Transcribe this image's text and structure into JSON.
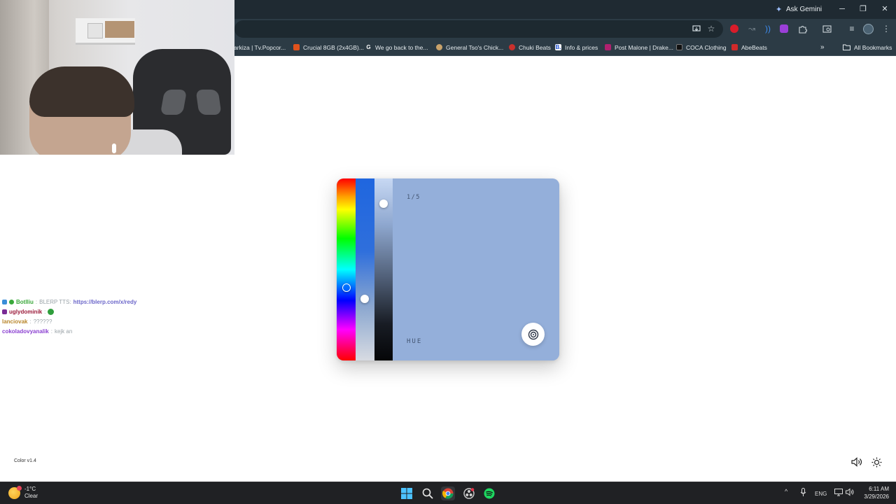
{
  "browser": {
    "ask_gemini": "Ask Gemini",
    "bookmarks": [
      {
        "label": "Markiza | Tv.Popcor...",
        "color": "#2c3b45",
        "glyph": ""
      },
      {
        "label": "Crucial 8GB (2x4GB)...",
        "color": "#e0521c",
        "glyph": ""
      },
      {
        "label": "We go back to the...",
        "color": "#ffffff",
        "glyph": "G"
      },
      {
        "label": "General Tso's Chick...",
        "color": "#c9a26a",
        "glyph": ""
      },
      {
        "label": "Chuki Beats",
        "color": "#c9302c",
        "glyph": ""
      },
      {
        "label": "Info & prices",
        "color": "#1b4fd0",
        "glyph": "B."
      },
      {
        "label": "Post Malone | Drake...",
        "color": "#b0206f",
        "glyph": ""
      },
      {
        "label": "COCA Clothing",
        "color": "#111111",
        "glyph": ""
      },
      {
        "label": "AbeBeats",
        "color": "#d12a2a",
        "glyph": ""
      }
    ],
    "all_bookmarks": "All Bookmarks"
  },
  "chat": [
    {
      "user": "Botlliu",
      "user_color": "#3aa83a",
      "sep": ":",
      "msg": "BLERP TTS:",
      "link": "https://blerp.com/x/redy"
    },
    {
      "user": "uglydominik",
      "user_color": "#9b1b3a",
      "sep": ":",
      "msg": "",
      "link": ""
    },
    {
      "user": "lanciovak",
      "user_color": "#b8862b",
      "sep": ":",
      "msg": "??????",
      "link": ""
    },
    {
      "user": "cokoladovyanalik",
      "user_color": "#8a3fd1",
      "sep": ":",
      "msg": "kejk an",
      "link": ""
    }
  ],
  "widget": {
    "counter": "1/5",
    "mode": "HUE",
    "preview_color": "#94afda",
    "hue_level": 0.6,
    "saturation_level": 0.66,
    "lightness_level": 0.14
  },
  "page": {
    "version": "Color v1.4"
  },
  "taskbar": {
    "temperature": "-1°C",
    "condition": "Clear",
    "language": "ENG",
    "time": "6:11 AM",
    "date": "3/29/2026"
  }
}
